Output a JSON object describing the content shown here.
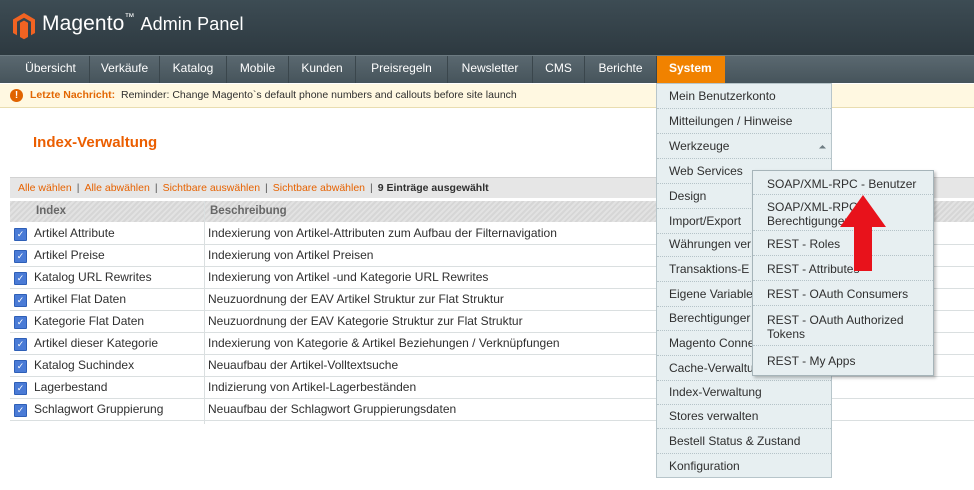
{
  "header": {
    "brand": "Magento",
    "brand_suffix": "Admin Panel"
  },
  "nav": {
    "items": [
      "Übersicht",
      "Verkäufe",
      "Katalog",
      "Mobile",
      "Kunden",
      "Preisregeln",
      "Newsletter",
      "CMS",
      "Berichte",
      "System"
    ],
    "active": "System"
  },
  "message": {
    "icon": "exclamation-icon",
    "prefix": "Letzte Nachricht:",
    "text": "Reminder: Change Magento`s default phone numbers and callouts before site launch"
  },
  "page_title": "Index-Verwaltung",
  "massaction": {
    "select_all": "Alle wählen",
    "deselect_all": "Alle abwählen",
    "select_visible": "Sichtbare auswählen",
    "deselect_visible": "Sichtbare abwählen",
    "separator": "|",
    "selected_count": "9 Einträge ausgewählt"
  },
  "table": {
    "columns": [
      "Index",
      "Beschreibung"
    ],
    "rows": [
      [
        "Artikel Attribute",
        "Indexierung von Artikel-Attributen zum Aufbau der Filternavigation"
      ],
      [
        "Artikel Preise",
        "Indexierung von Artikel Preisen"
      ],
      [
        "Katalog URL Rewrites",
        "Indexierung von Artikel -und Kategorie URL Rewrites"
      ],
      [
        "Artikel Flat Daten",
        "Neuzuordnung der EAV Artikel Struktur zur Flat Struktur"
      ],
      [
        "Kategorie Flat Daten",
        "Neuzuordnung der EAV Kategorie Struktur zur Flat Struktur"
      ],
      [
        "Artikel dieser Kategorie",
        "Indexierung von Kategorie & Artikel Beziehungen / Verknüpfungen"
      ],
      [
        "Katalog Suchindex",
        "Neuaufbau der Artikel-Volltextsuche"
      ],
      [
        "Lagerbestand",
        "Indizierung von Artikel-Lagerbeständen"
      ],
      [
        "Schlagwort Gruppierung",
        "Neuaufbau der Schlagwort Gruppierungsdaten"
      ]
    ],
    "checkbox_mark": "✓"
  },
  "system_menu": {
    "items": [
      "Mein Benutzerkonto",
      "Mitteilungen / Hinweise",
      "Werkzeuge",
      "Web Services",
      "Design",
      "Import/Export",
      "Währungen ver",
      "Transaktions-E",
      "Eigene Variable",
      "Berechtigunger",
      "Magento Conne",
      "Cache-Verwaltu",
      "Index-Verwaltung",
      "Stores verwalten",
      "Bestell Status & Zustand",
      "Konfiguration"
    ]
  },
  "web_services_submenu": {
    "items": [
      [
        "SOAP/XML-RPC - Benutzer"
      ],
      [
        "SOAP/XML-RPC -",
        "Berechtigungen"
      ],
      [
        "REST - Roles"
      ],
      [
        "REST - Attributes"
      ],
      [
        "REST - OAuth Consumers"
      ],
      [
        "REST - OAuth Authorized",
        "Tokens"
      ],
      [
        "REST - My Apps"
      ]
    ]
  },
  "annotation": {
    "icon": "red-arrow-icon",
    "color": "#e8121b"
  },
  "colors": {
    "accent": "#eb5e00",
    "nav_active": "#f18200",
    "header": "#2d3940"
  }
}
